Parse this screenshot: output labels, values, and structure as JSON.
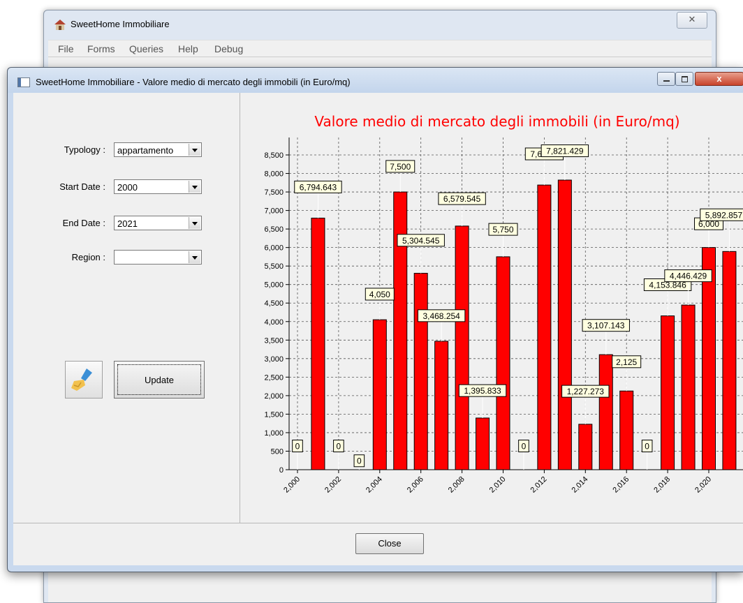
{
  "main_window": {
    "title": "SweetHome Immobiliare",
    "close_symbol": "✕",
    "menu": [
      "File",
      "Forms",
      "Queries",
      "Help",
      "Debug"
    ]
  },
  "dialog": {
    "title": "SweetHome Immobiliare - Valore medio di mercato degli immobili (in Euro/mq)",
    "close_symbol": "x",
    "filters": {
      "typology_label": "Typology :",
      "typology_value": "appartamento",
      "start_date_label": "Start Date :",
      "start_date_value": "2000",
      "end_date_label": "End Date :",
      "end_date_value": "2021",
      "region_label": "Region :",
      "region_value": ""
    },
    "update_label": "Update",
    "close_label": "Close"
  },
  "chart_data": {
    "type": "bar",
    "title": "Valore medio di mercato degli immobili (in Euro/mq)",
    "x": [
      2000,
      2001,
      2002,
      2003,
      2004,
      2005,
      2006,
      2007,
      2008,
      2009,
      2010,
      2011,
      2012,
      2013,
      2014,
      2015,
      2016,
      2017,
      2018,
      2019,
      2020,
      2021
    ],
    "values": [
      0,
      6794.643,
      0,
      0,
      4050,
      7500,
      5304.545,
      3468.254,
      6579.545,
      1395.833,
      5750,
      0,
      7687.5,
      7821.429,
      1227.273,
      3107.143,
      2125,
      0,
      4153.846,
      4446.429,
      6000,
      5892.857
    ],
    "labels": [
      "0",
      "6,794.643",
      "0",
      "0",
      "4,050",
      "7,500",
      "5,304.545",
      "3,468.254",
      "6,579.545",
      "1,395.833",
      "5,750",
      "0",
      "7,687.5",
      "7,821.429",
      "1,227.273",
      "3,107.143",
      "2,125",
      "0",
      "4,153.846",
      "4,446.429",
      "6,000",
      "5,892.857"
    ],
    "x_tick_labels": [
      "2,000",
      "2,002",
      "2,004",
      "2,006",
      "2,008",
      "2,010",
      "2,012",
      "2,014",
      "2,016",
      "2,018",
      "2,020"
    ],
    "y_tick_labels": [
      "0",
      "500",
      "1,000",
      "1,500",
      "2,000",
      "2,500",
      "3,000",
      "3,500",
      "4,000",
      "4,500",
      "5,000",
      "5,500",
      "6,000",
      "6,500",
      "7,000",
      "7,500",
      "8,000",
      "8,500"
    ],
    "ylim": [
      0,
      8500
    ],
    "grid": true,
    "bar_color": "#ff0000",
    "title_color": "#ff0000",
    "label_background": "#ffffe0"
  }
}
